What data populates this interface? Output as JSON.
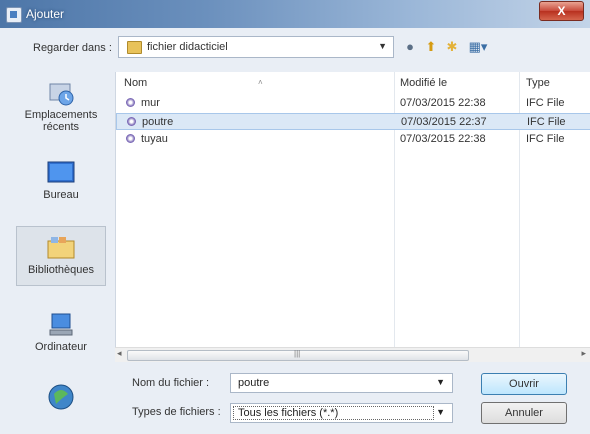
{
  "window": {
    "title": "Ajouter",
    "close_label": "X"
  },
  "lookin": {
    "label": "Regarder dans :",
    "value": "fichier didacticiel"
  },
  "toolbar": {
    "back": "●",
    "up": "⬆",
    "newfolder": "✱",
    "views": "▦▾"
  },
  "places": [
    {
      "label": "Emplacements récents",
      "icon": "recent-places-icon"
    },
    {
      "label": "Bureau",
      "icon": "desktop-icon"
    },
    {
      "label": "Bibliothèques",
      "icon": "libraries-icon"
    },
    {
      "label": "Ordinateur",
      "icon": "computer-icon"
    },
    {
      "label": "",
      "icon": "network-icon"
    }
  ],
  "columns": {
    "name": "Nom",
    "modified": "Modifié le",
    "type": "Type"
  },
  "files": [
    {
      "name": "mur",
      "modified": "07/03/2015 22:38",
      "type": "IFC File"
    },
    {
      "name": "poutre",
      "modified": "07/03/2015 22:37",
      "type": "IFC File"
    },
    {
      "name": "tuyau",
      "modified": "07/03/2015 22:38",
      "type": "IFC File"
    }
  ],
  "filename": {
    "label": "Nom du fichier :",
    "value": "poutre"
  },
  "filetype": {
    "label": "Types de fichiers :",
    "value": "Tous les fichiers (*.*)"
  },
  "buttons": {
    "open": "Ouvrir",
    "cancel": "Annuler"
  }
}
